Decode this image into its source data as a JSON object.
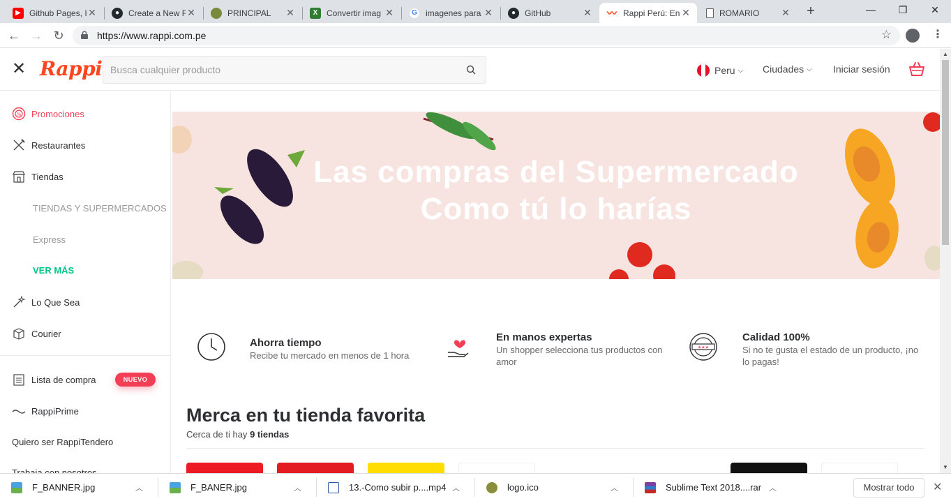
{
  "browser": {
    "tabs": [
      {
        "title": "Github Pages, I",
        "icon": "youtube-icon",
        "color": "#ff0000"
      },
      {
        "title": "Create a New F",
        "icon": "github-icon",
        "color": "#24292e"
      },
      {
        "title": "PRINCIPAL",
        "icon": "site-icon",
        "color": "#7a8a3a"
      },
      {
        "title": "Convertir imag",
        "icon": "converter-icon",
        "color": "#2e7d32"
      },
      {
        "title": "imagenes para",
        "icon": "google-icon",
        "color": "#4285f4"
      },
      {
        "title": "GitHub",
        "icon": "github-icon",
        "color": "#24292e"
      },
      {
        "title": "Rappi Perú: En",
        "icon": "rappi-icon",
        "color": "#ff441f"
      },
      {
        "title": "ROMARIO",
        "icon": "document-icon",
        "color": "#ffffff"
      }
    ],
    "url": "https://www.rappi.com.pe"
  },
  "header": {
    "logo": "Rappi",
    "search_placeholder": "Busca cualquier producto",
    "country": "Peru",
    "cities": "Ciudades",
    "login": "Iniciar sesión"
  },
  "sidebar": {
    "items": [
      {
        "label": "Promociones",
        "icon": "promo-icon"
      },
      {
        "label": "Restaurantes",
        "icon": "cutlery-icon"
      },
      {
        "label": "Tiendas",
        "icon": "store-icon"
      },
      {
        "label": "Lo Que Sea",
        "icon": "wand-icon"
      },
      {
        "label": "Courier",
        "icon": "box-icon"
      },
      {
        "label": "Lista de compra",
        "icon": "list-icon"
      },
      {
        "label": "RappiPrime",
        "icon": "prime-icon"
      },
      {
        "label": "Quiero ser RappiTendero",
        "icon": ""
      },
      {
        "label": "Trabaja con nosotros",
        "icon": ""
      }
    ],
    "sub": [
      "TIENDAS Y SUPERMERCADOS",
      "Express",
      "VER MÁS"
    ],
    "badge": "NUEVO"
  },
  "banner": {
    "line1": "Las compras del Supermercado",
    "line2": "Como tú lo harías"
  },
  "features": [
    {
      "title": "Ahorra tiempo",
      "desc": "Recibe tu mercado en menos de 1 hora",
      "icon": "clock-icon"
    },
    {
      "title": "En manos expertas",
      "desc": "Un shopper selecciona tus productos con amor",
      "icon": "heart-hand-icon"
    },
    {
      "title": "Calidad 100%",
      "desc": "Si no te gusta el estado de un producto, ¡no lo pagas!",
      "icon": "quality-seal-icon"
    }
  ],
  "stores_section": {
    "title": "Merca en tu tienda favorita",
    "sub_prefix": "Cerca de ti hay",
    "sub_count": "9 tiendas",
    "store_colors": [
      "#ed1c24",
      "#e31b23",
      "#ffdd00",
      "#ffffff",
      "#ffffff",
      "#111111",
      "#ffffff"
    ]
  },
  "downloads": [
    {
      "name": "F_BANNER.jpg",
      "icon": "image-file-icon"
    },
    {
      "name": "F_BANER.jpg",
      "icon": "image-file-icon"
    },
    {
      "name": "13.-Como subir p....mp4",
      "icon": "video-file-icon"
    },
    {
      "name": "logo.ico",
      "icon": "ico-file-icon"
    },
    {
      "name": "Sublime Text 2018....rar",
      "icon": "archive-file-icon"
    }
  ],
  "show_all": "Mostrar todo",
  "colors": {
    "brand": "#ff441f",
    "accent_pink": "#f33e56",
    "accent_green": "#00c389",
    "banner_bg": "#f7e4e1"
  }
}
